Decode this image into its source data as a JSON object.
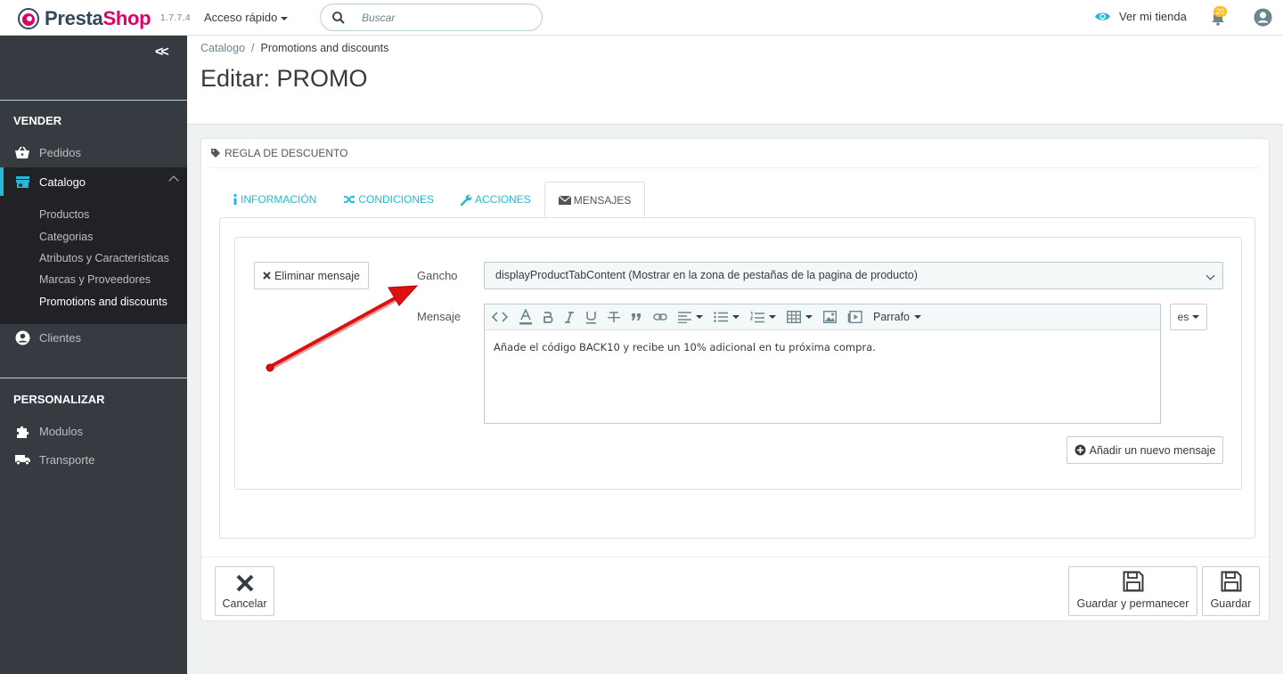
{
  "topbar": {
    "logo_presta": "Presta",
    "logo_shop": "Shop",
    "version": "1.7.7.4",
    "quick_access": "Acceso rápido",
    "search_placeholder": "Buscar",
    "view_shop": "Ver mi tienda",
    "notifications_count": "20"
  },
  "sidebar": {
    "section_sell": "VENDER",
    "orders": "Pedidos",
    "catalog": "Catalogo",
    "catalog_sub": [
      "Productos",
      "Categorias",
      "Atributos y Características",
      "Marcas y Proveedores",
      "Promotions and discounts"
    ],
    "customers": "Clientes",
    "section_customize": "PERSONALIZAR",
    "modules": "Modulos",
    "shipping": "Transporte"
  },
  "header": {
    "breadcrumb_parent": "Catalogo",
    "breadcrumb_separator": "/",
    "breadcrumb_current": "Promotions and discounts",
    "title": "Editar: PROMO"
  },
  "panel": {
    "heading": "REGLA DE DESCUENTO",
    "tabs": [
      "INFORMACIÓN",
      "CONDICIONES",
      "ACCIONES",
      "MENSAJES"
    ],
    "delete_message": "Eliminar mensaje",
    "hook_label": "Gancho",
    "hook_value": "displayProductTabContent (Mostrar en la zona de pestañas de la pagina de producto)",
    "message_label": "Mensaje",
    "paragraph_format": "Parrafo",
    "message_text": "Añade el código BACK10 y recibe un 10% adicional en tu próxima compra.",
    "language": "es",
    "add_message": "Añadir un nuevo mensaje"
  },
  "footer": {
    "cancel": "Cancelar",
    "save_stay": "Guardar y permanecer",
    "save": "Guardar"
  },
  "colors": {
    "accent": "#25b9d7",
    "sidebar_bg": "#363a41",
    "sidebar_active": "#202226",
    "brand_pink": "#df0067",
    "annotation_arrow": "#e01010"
  }
}
